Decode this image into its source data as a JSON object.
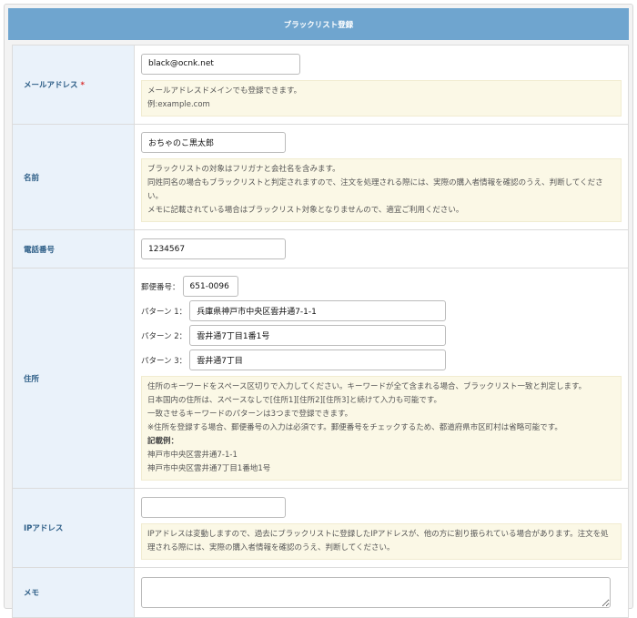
{
  "header": {
    "title": "ブラックリスト登録"
  },
  "email": {
    "label": "メールアドレス",
    "required_mark": "*",
    "value": "black@ocnk.net",
    "notes": [
      "メールアドレスドメインでも登録できます。",
      "例:example.com"
    ]
  },
  "name": {
    "label": "名前",
    "value": "おちゃのこ黒太郎",
    "notes": [
      "ブラックリストの対象はフリガナと会社名を含みます。",
      "同姓同名の場合もブラックリストと判定されますので、注文を処理される際には、実際の購入者情報を確認のうえ、判断してください。",
      "メモに記載されている場合はブラックリスト対象となりませんので、適宜ご利用ください。"
    ]
  },
  "phone": {
    "label": "電話番号",
    "value": "1234567"
  },
  "address": {
    "label": "住所",
    "postal_label": "郵便番号：",
    "postal_value": "651-0096",
    "patterns": [
      {
        "label": "パターン 1：",
        "value": "兵庫県神戸市中央区雲井通7-1-1"
      },
      {
        "label": "パターン 2：",
        "value": "雲井通7丁目1番1号"
      },
      {
        "label": "パターン 3：",
        "value": "雲井通7丁目"
      }
    ],
    "notes": [
      "住所のキーワードをスペース区切りで入力してください。キーワードが全て含まれる場合、ブラックリスト一致と判定します。",
      "日本国内の住所は、スペースなしで[住所1][住所2][住所3]と続けて入力も可能です。",
      "一致させるキーワードのパターンは3つまで登録できます。",
      "※住所を登録する場合、郵便番号の入力は必須です。郵便番号をチェックするため、都道府県市区町村は省略可能です。"
    ],
    "example_heading": "記載例：",
    "examples": [
      "神戸市中央区雲井通7-1-1",
      "神戸市中央区雲井通7丁目1番地1号"
    ]
  },
  "ip": {
    "label": "IPアドレス",
    "value": "",
    "notes": [
      "IPアドレスは変動しますので、過去にブラックリストに登録したIPアドレスが、他の方に割り振られている場合があります。注文を処理される際には、実際の購入者情報を確認のうえ、判断してください。"
    ]
  },
  "memo": {
    "label": "メモ",
    "value": ""
  }
}
